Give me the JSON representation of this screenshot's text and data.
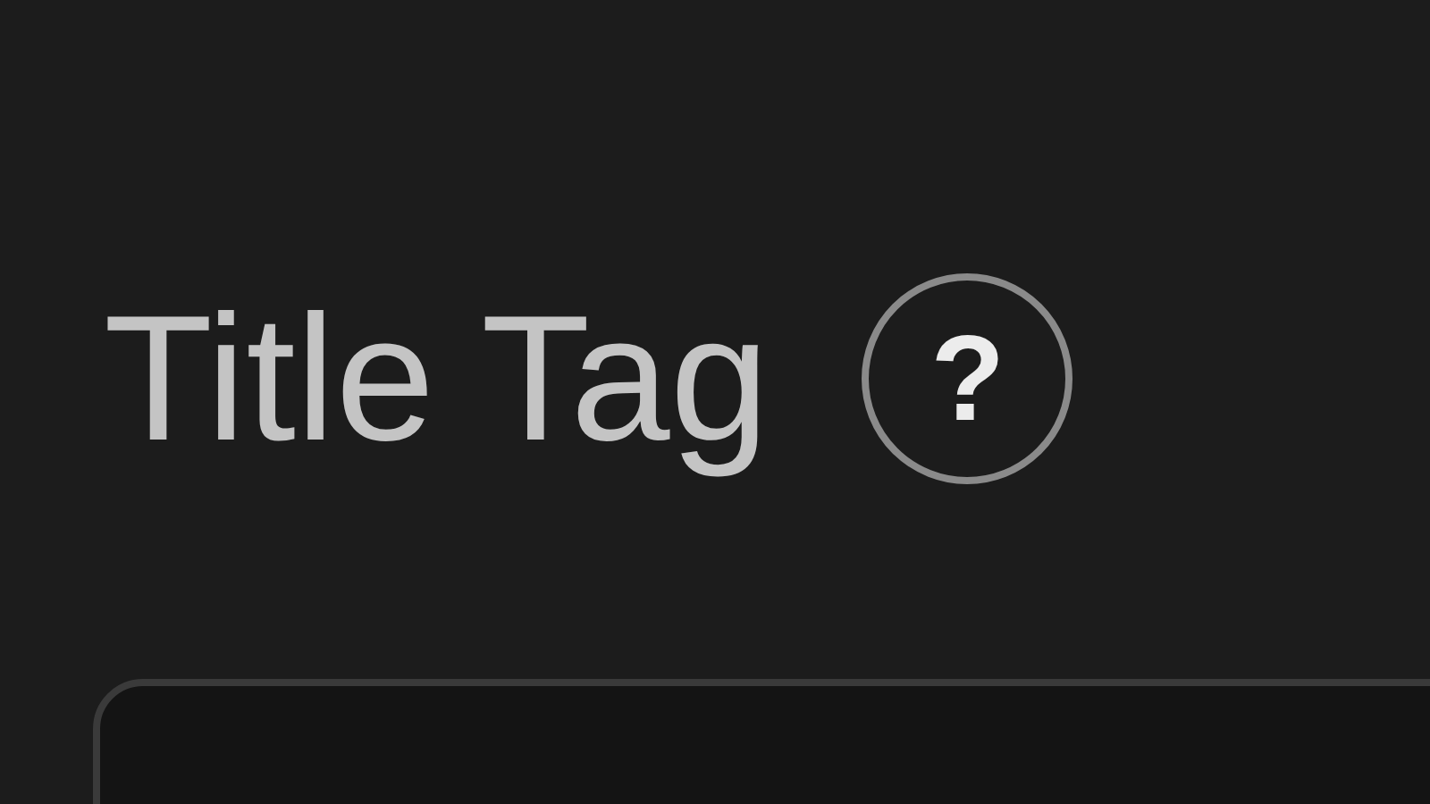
{
  "field": {
    "label": "Title Tag",
    "help_glyph": "?"
  }
}
